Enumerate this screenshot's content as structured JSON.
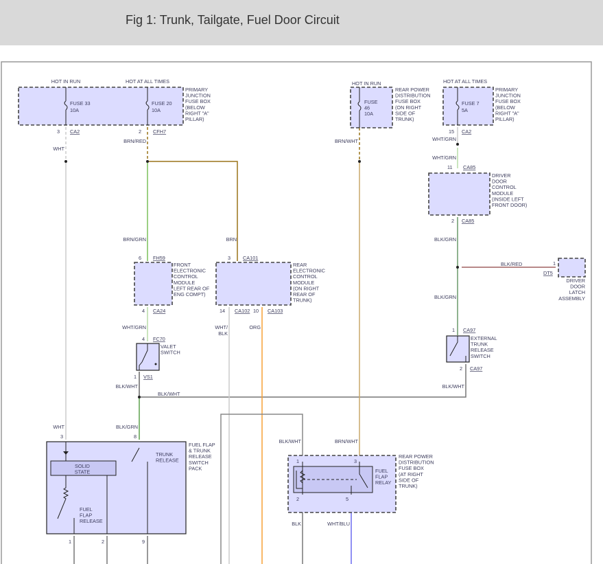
{
  "header": {
    "title": "Fig 1: Trunk, Tailgate, Fuel Door Circuit"
  },
  "pjb_left": {
    "hot_run": "HOT IN RUN",
    "hot_all": "HOT AT ALL TIMES",
    "fuse_a": "FUSE 33",
    "fuse_a_amp": "10A",
    "fuse_b": "FUSE 20",
    "fuse_b_amp": "10A",
    "label": [
      "PRIMARY",
      "JUNCTION",
      "FUSE BOX",
      "(BELOW",
      "RIGHT \"A\"",
      "PILLAR)"
    ],
    "pin_a": "3",
    "conn_a": "CA2",
    "pin_b": "2",
    "conn_b": "CFH7"
  },
  "rpdb_top": {
    "hot_run": "HOT IN RUN",
    "fuse": [
      "FUSE",
      "46",
      "10A"
    ],
    "label": [
      "REAR POWER",
      "DISTRIBUTION",
      "FUSE BOX",
      "(ON RIGHT",
      "SIDE OF",
      "TRUNK)"
    ]
  },
  "pjb_right": {
    "hot_all": "HOT AT ALL TIMES",
    "fuse": "FUSE 7",
    "fuse_amp": "5A",
    "label": [
      "PRIMARY",
      "JUNCTION",
      "FUSE BOX",
      "(BELOW",
      "RIGHT \"A\"",
      "PILLAR)"
    ],
    "pin": "15",
    "conn": "CA2"
  },
  "ddcm": {
    "label": [
      "DRIVER",
      "DOOR",
      "CONTROL",
      "MODULE",
      "(INSIDE LEFT",
      "FRONT DOOR)"
    ],
    "pin_top": "11",
    "conn_top": "CA85",
    "pin_bot": "2",
    "conn_bot": "CA85"
  },
  "latch": {
    "label": [
      "DRIVER",
      "DOOR",
      "LATCH",
      "ASSEMBLY"
    ],
    "pin": "1",
    "conn": "DT5"
  },
  "fecm": {
    "label": [
      "FRONT",
      "ELECTRONIC",
      "CONTROL",
      "MODULE",
      "LEFT REAR OF",
      "ENG COMPT)"
    ],
    "pin_top": "6",
    "conn_top": "FH59",
    "pin_bot": "4",
    "conn_bot": "CA24"
  },
  "recm": {
    "label": [
      "REAR",
      "ELECTRONIC",
      "CONTROL",
      "MODULE",
      "(ON RIGHT",
      "REAR OF",
      "TRUNK)"
    ],
    "pin_top": "3",
    "conn_top": "CA101",
    "pin_a": "14",
    "conn_a": "CA102",
    "pin_b": "10",
    "conn_b": "CA103"
  },
  "valet": {
    "label": [
      "VALET",
      "SWITCH"
    ],
    "pin_top": "4",
    "conn_top": "FC70",
    "pin_bot": "1",
    "conn_bot": "VS1"
  },
  "ext_switch": {
    "label": [
      "EXTERNAL",
      "TRUNK",
      "RELEASE",
      "SWITCH"
    ],
    "pin_top": "1",
    "conn_top": "CA97",
    "pin_bot": "2",
    "conn_bot": "CA97"
  },
  "switch_pack": {
    "label": [
      "FUEL FLAP",
      "& TRUNK",
      "RELEASE",
      "SWITCH",
      "PACK"
    ],
    "solid_state": [
      "SOLID",
      "STATE"
    ],
    "trunk_release": [
      "TRUNK",
      "RELEASE"
    ],
    "fuel_flap_release": [
      "FUEL",
      "FLAP",
      "RELEASE"
    ],
    "pins": [
      "3",
      "8",
      "1",
      "2",
      "9"
    ]
  },
  "relay_box": {
    "label": [
      "REAR POWER",
      "DISTRIBUTION",
      "FUSE BOX",
      "(AT RIGHT",
      "SIDE OF",
      "TRUNK)"
    ],
    "relay": [
      "FUEL",
      "FLAP",
      "RELAY"
    ],
    "pins": [
      "1",
      "3",
      "2",
      "5"
    ]
  },
  "wires": {
    "wht": "WHT",
    "brn_red": "BRN/RED",
    "brn_grn": "BRN/GRN",
    "brn": "BRN",
    "brn_wht": "BRN/WHT",
    "wht_grn_a": "WHT/GRN",
    "wht_grn_b": "WHT/GRN",
    "wht_grn_c": "WHT/GRN",
    "blk_grn_a": "BLK/GRN",
    "blk_red": "BLK/RED",
    "blk_grn_b": "BLK/GRN",
    "wht_blk": [
      "WHT/",
      "BLK"
    ],
    "org": "ORG",
    "blk_wht_a": "BLK/WHT",
    "blk_wht_b": "BLK/WHT",
    "blk_wht_c": "BLK/WHT",
    "wht_b": "WHT",
    "blk_grn_c": "BLK/GRN",
    "blk_wht_d": "BLK/WHT",
    "brn_wht_b": "BRN/WHT",
    "blk": "BLK",
    "wht_blu": "WHT/BLU"
  },
  "colors": {
    "module_fill": "#dcdcff",
    "orange": "#f7a035",
    "green": "#7cc05a",
    "brown": "#9a7318",
    "tan": "#c8a86a",
    "blue": "#6a6af0"
  }
}
